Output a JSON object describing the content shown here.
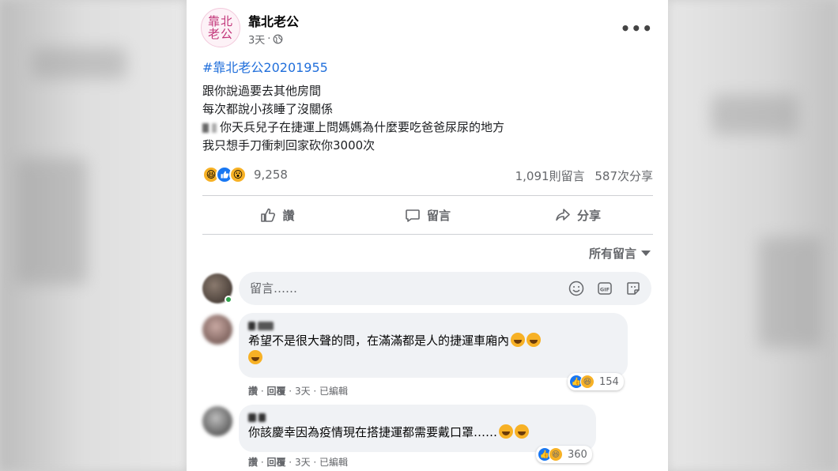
{
  "post": {
    "page_name": "靠北老公",
    "avatar_text": "靠北老公",
    "time": "3天",
    "hashtag": "#靠北老公20201955",
    "lines": [
      "跟你說過要去其他房間",
      "每次都說小孩睡了沒關係",
      "你天兵兒子在捷運上問媽媽為什麼要吃爸爸尿尿的地方",
      "我只想手刀衝刺回家砍你3000次"
    ],
    "reaction_count": "9,258",
    "comment_count": "1,091則留言",
    "share_count": "587次分享",
    "reactions": [
      "haha-icon",
      "like-icon",
      "wow-icon"
    ]
  },
  "actions": {
    "like": "讚",
    "comment": "留言",
    "share": "分享"
  },
  "sort": {
    "label": "所有留言"
  },
  "comment_box": {
    "placeholder": "留言……"
  },
  "comments": [
    {
      "text": "希望不是很大聲的問，在滿滿都是人的捷運車廂內",
      "like_label": "讚",
      "reply_label": "回覆",
      "time": "3天",
      "edited": "已編輯",
      "reaction_count": "154"
    },
    {
      "text": "你該慶幸因為疫情現在搭捷運都需要戴口罩……",
      "like_label": "讚",
      "reply_label": "回覆",
      "time": "3天",
      "edited": "已編輯",
      "reaction_count": "360"
    }
  ],
  "colors": {
    "link": "#216fdb",
    "like_blue": "#1877f2",
    "reaction_yellow": "#f7b125",
    "secondary_text": "#65676b",
    "bubble_bg": "#f0f2f5"
  }
}
